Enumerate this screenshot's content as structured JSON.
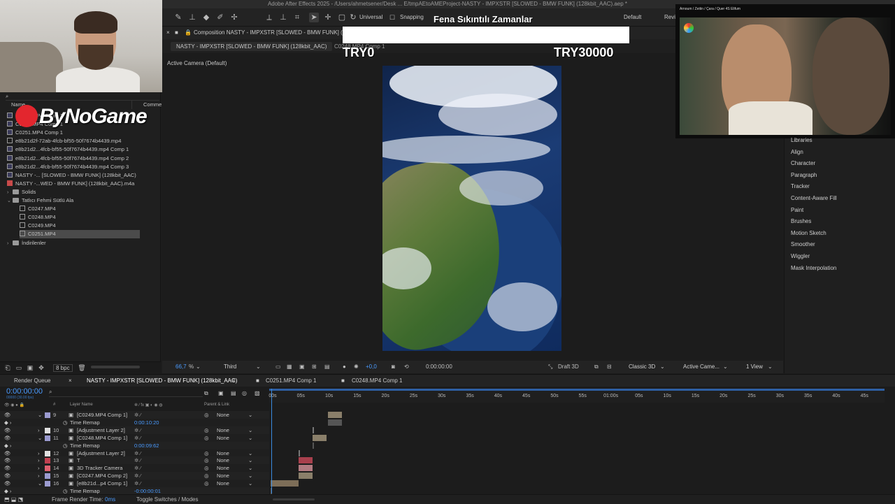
{
  "app": {
    "title": "Adobe After Effects 2025 - /Users/ahmetsener/Desk ... E/tmpAEtoAMEProject-NASTY - IMPXSTR [SLOWED - BMW FUNK] (128kbit_AAC).aep *"
  },
  "toolbar": {
    "universal_label": "Universal",
    "snapping_label": "Snapping",
    "workspace": "Default",
    "workspace2": "Revi"
  },
  "overlay": {
    "donation_title": "Fena Sıkıntılı Zamanlar",
    "donation_current": "TRY0",
    "donation_goal": "TRY30000",
    "logo_text": "ByNoGame",
    "movie_caption": "Arnoum / Zeitin / Çara / Quer 4S Elifum"
  },
  "project": {
    "col_name": "Name",
    "col_comment": "Comme",
    "items": [
      {
        "label": "C0248.MP4 Comp 1",
        "type": "comp"
      },
      {
        "label": "C0249.MP4 Comp 1",
        "type": "comp"
      },
      {
        "label": "C0251.MP4 Comp 1",
        "type": "comp"
      },
      {
        "label": "e8b21d2f-72ab-4fcb-bf55-50f7674b4439.mp4",
        "type": "file"
      },
      {
        "label": "e8b21d2...4fcb-bf55-50f7674b4439.mp4 Comp 1",
        "type": "comp"
      },
      {
        "label": "e8b21d2...4fcb-bf55-50f7674b4439.mp4 Comp 2",
        "type": "comp"
      },
      {
        "label": "e8b21d2...4fcb-bf55-50f7674b4439.mp4 Comp 3",
        "type": "comp"
      },
      {
        "label": "NASTY -... [SLOWED - BMW FUNK] (128kbit_AAC)",
        "type": "comp"
      },
      {
        "label": "NASTY -...WED - BMW FUNK] (128kbit_AAC).m4a",
        "type": "audio"
      },
      {
        "label": "Solids",
        "type": "folder"
      },
      {
        "label": "Tatlıcı Fehmi Sütlü Ala",
        "type": "folder"
      },
      {
        "label": "C0247.MP4",
        "type": "file",
        "indent": true
      },
      {
        "label": "C0248.MP4",
        "type": "file",
        "indent": true
      },
      {
        "label": "C0249.MP4",
        "type": "file",
        "indent": true
      },
      {
        "label": "C0251.MP4",
        "type": "file",
        "indent": true,
        "selected": true
      },
      {
        "label": "İndirilenler",
        "type": "folder"
      }
    ],
    "bpc": "8 bpc"
  },
  "composition": {
    "panel_title": "Composition NASTY - IMPXSTR [SLOWED - BMW FUNK] (128k",
    "tab_active": "NASTY - IMPXSTR [SLOWED - BMW FUNK] (128kbit_AAC)",
    "tab_other": "C0248.MP4 Comp 1",
    "camera_label": "Active Camera (Default)",
    "zoom": "66,7",
    "zoom_unit": "%",
    "resolution": "Third",
    "exposure": "+0,0",
    "timecode": "0:00:00:00",
    "draft3d": "Draft 3D",
    "renderer": "Classic 3D",
    "camera_view": "Active Came...",
    "views": "1 View"
  },
  "right_panel": {
    "items": [
      "Libraries",
      "Align",
      "Character",
      "Paragraph",
      "Tracker",
      "Content-Aware Fill",
      "Paint",
      "Brushes",
      "Motion Sketch",
      "Smoother",
      "Wiggler",
      "Mask Interpolation"
    ]
  },
  "timeline": {
    "tab_render_queue": "Render Queue",
    "tab_main": "NASTY - IMPXSTR [SLOWED - BMW FUNK] (128kbit_AAC)",
    "tab_c0251": "C0251.MP4 Comp 1",
    "tab_c0248": "C0248.MP4 Comp 1",
    "timecode": "0:00:00:00",
    "fps_sub": "00000 (30.00 fps)",
    "col_hash": "#",
    "col_layer_name": "Layer Name",
    "col_parent": "Parent & Link",
    "ticks": [
      "00s",
      "05s",
      "10s",
      "15s",
      "20s",
      "25s",
      "30s",
      "35s",
      "40s",
      "45s",
      "50s",
      "55s",
      "01:00s",
      "05s",
      "10s",
      "15s",
      "20s",
      "25s",
      "30s",
      "35s",
      "40s",
      "45s"
    ],
    "layers": [
      {
        "num": "9",
        "name": "[C0249.MP4 Comp 1]",
        "color": "#9b9bd0",
        "parent": "None",
        "expanded": true
      },
      {
        "num": "",
        "name": "Time Remap",
        "sub": true,
        "value": "0:00:10:20"
      },
      {
        "num": "10",
        "name": "[Adjustment Layer 2]",
        "color": "#e0e0e0",
        "parent": "None"
      },
      {
        "num": "11",
        "name": "[C0248.MP4 Comp 1]",
        "color": "#9b9bd0",
        "parent": "None",
        "expanded": true
      },
      {
        "num": "",
        "name": "Time Remap",
        "sub": true,
        "value": "0:00:09:62"
      },
      {
        "num": "12",
        "name": "[Adjustment Layer 2]",
        "color": "#e0e0e0",
        "parent": "None"
      },
      {
        "num": "13",
        "name": "T",
        "color": "#c04050",
        "parent": "None"
      },
      {
        "num": "14",
        "name": "3D Tracker Camera",
        "color": "#e06070",
        "parent": "None"
      },
      {
        "num": "15",
        "name": "[C0247.MP4 Comp 2]",
        "color": "#9b9bd0",
        "parent": "None"
      },
      {
        "num": "16",
        "name": "[e8b21d...p4 Comp 1]",
        "color": "#9b9bd0",
        "parent": "None",
        "expanded": true
      },
      {
        "num": "",
        "name": "Time Remap",
        "sub": true,
        "value": "-0:00:00:01"
      }
    ],
    "frame_render_label": "Frame Render Time:",
    "frame_render_value": "0ms",
    "toggle_label": "Toggle Switches / Modes"
  }
}
